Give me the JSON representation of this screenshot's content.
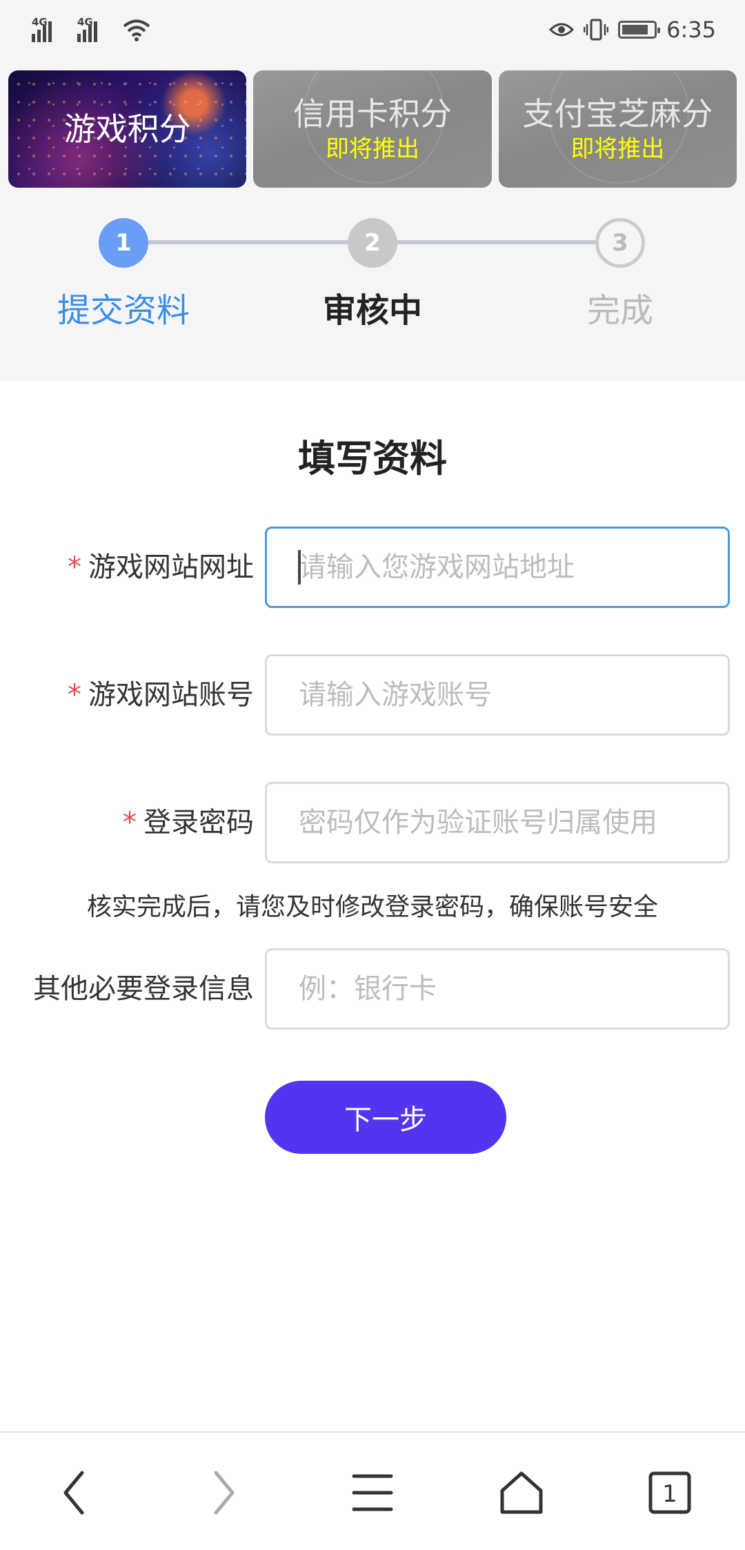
{
  "status_bar": {
    "network_1": "4G",
    "network_2": "4G",
    "battery_percent": 85,
    "time": "6:35"
  },
  "cards": [
    {
      "title": "游戏积分",
      "subtitle": "",
      "active": true
    },
    {
      "title": "信用卡积分",
      "subtitle": "即将推出",
      "active": false
    },
    {
      "title": "支付宝芝麻分",
      "subtitle": "即将推出",
      "active": false
    }
  ],
  "steps": [
    {
      "number": "1",
      "label": "提交资料",
      "state": "active"
    },
    {
      "number": "2",
      "label": "审核中",
      "state": "pending"
    },
    {
      "number": "3",
      "label": "完成",
      "state": "disabled"
    }
  ],
  "form": {
    "title": "填写资料",
    "fields": [
      {
        "label": "游戏网站网址",
        "required": true,
        "placeholder": "请输入您游戏网站地址",
        "value": ""
      },
      {
        "label": "游戏网站账号",
        "required": true,
        "placeholder": "请输入游戏账号",
        "value": ""
      },
      {
        "label": "登录密码",
        "required": true,
        "placeholder": "密码仅作为验证账号归属使用",
        "value": ""
      },
      {
        "label": "其他必要登录信息",
        "required": false,
        "placeholder": "例：银行卡",
        "value": ""
      }
    ],
    "note": "核实完成后，请您及时修改登录密码，确保账号安全",
    "required_mark": "*",
    "next_label": "下一步"
  },
  "bottom_nav": {
    "tab_count": "1",
    "icons": [
      "back-icon",
      "forward-icon",
      "menu-icon",
      "home-icon",
      "tabs-icon"
    ]
  },
  "colors": {
    "accent_blue": "#3b8ee8",
    "step_active": "#6a9df5",
    "button_purple": "#5235f0",
    "required_red": "#e34b4b",
    "coming_soon_yellow": "#ffff00"
  }
}
